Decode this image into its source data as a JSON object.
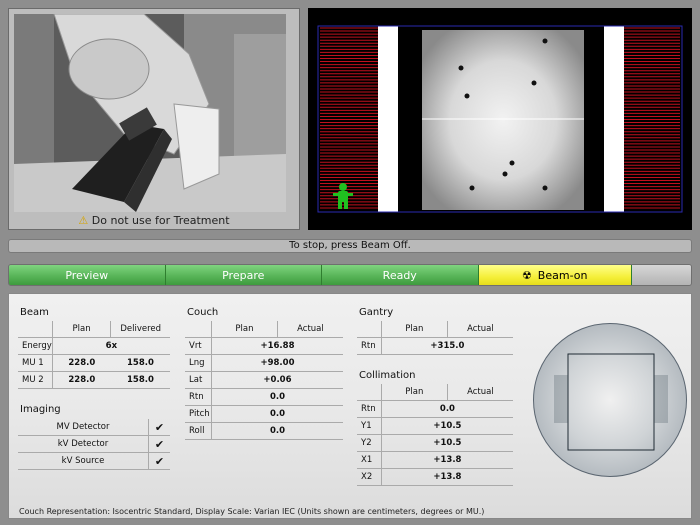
{
  "camera": {
    "warning_text": "Do not use for Treatment"
  },
  "status": {
    "message": "To stop, press Beam Off."
  },
  "workflow": {
    "steps": [
      "Preview",
      "Prepare",
      "Ready",
      "Beam-on"
    ]
  },
  "beam": {
    "title": "Beam",
    "headers": [
      "Plan",
      "Delivered"
    ],
    "rows": [
      {
        "label": "Energy",
        "merged": "6x"
      },
      {
        "label": "MU 1",
        "plan": "228.0",
        "delivered": "158.0"
      },
      {
        "label": "MU 2",
        "plan": "228.0",
        "delivered": "158.0"
      }
    ]
  },
  "imaging": {
    "title": "Imaging",
    "rows": [
      {
        "label": "MV Detector",
        "check": "✔"
      },
      {
        "label": "kV Detector",
        "check": "✔"
      },
      {
        "label": "kV Source",
        "check": "✔"
      }
    ]
  },
  "couch": {
    "title": "Couch",
    "headers": [
      "Plan",
      "Actual"
    ],
    "rows": [
      {
        "label": "Vrt",
        "value": "+16.88"
      },
      {
        "label": "Lng",
        "value": "+98.00"
      },
      {
        "label": "Lat",
        "value": "+0.06"
      },
      {
        "label": "Rtn",
        "value": "0.0"
      },
      {
        "label": "Pitch",
        "value": "0.0"
      },
      {
        "label": "Roll",
        "value": "0.0"
      }
    ]
  },
  "gantry": {
    "title": "Gantry",
    "headers": [
      "Plan",
      "Actual"
    ],
    "rows": [
      {
        "label": "Rtn",
        "value": "+315.0"
      }
    ]
  },
  "collimation": {
    "title": "Collimation",
    "headers": [
      "Plan",
      "Actual"
    ],
    "rows": [
      {
        "label": "Rtn",
        "value": "0.0"
      },
      {
        "label": "Y1",
        "value": "+10.5"
      },
      {
        "label": "Y2",
        "value": "+10.5"
      },
      {
        "label": "X1",
        "value": "+13.8"
      },
      {
        "label": "X2",
        "value": "+13.8"
      }
    ]
  },
  "footer": {
    "note": "Couch Representation: Isocentric Standard, Display Scale: Varian IEC (Units shown are centimeters, degrees or MU.)"
  },
  "icons": {
    "warning": "warning-triangle-icon",
    "radiation": "radiation-trefoil-icon",
    "patient": "green-figure-icon"
  },
  "colors": {
    "workflow_green": "#55b255",
    "beam_on_yellow": "#f5ef3a",
    "leaf_red": "#c0101d"
  }
}
